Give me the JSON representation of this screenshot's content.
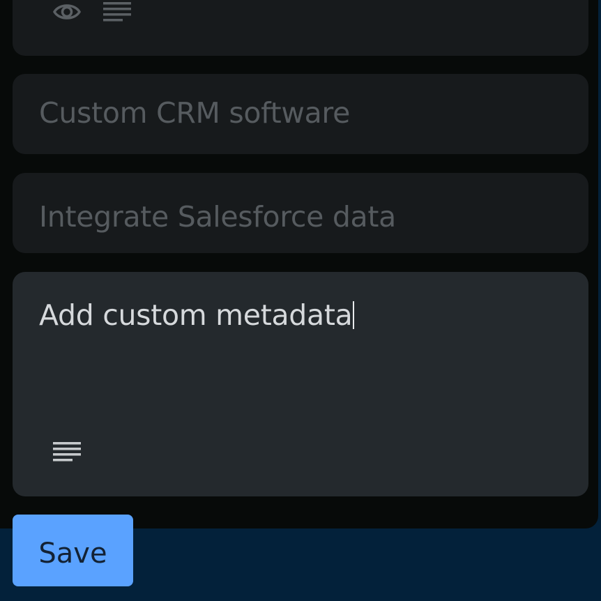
{
  "colors": {
    "page_background": "#03213a",
    "panel_background": "#070a09",
    "card_background": "#171a1c",
    "active_card_background": "#24292d",
    "placeholder_text": "#565b5f",
    "value_text": "#d6d9dc",
    "button_background": "#5aa2ff",
    "button_text": "#132234",
    "icon_color": "#5b6064"
  },
  "top_card": {
    "icons": [
      "eye-icon",
      "text-lines-icon"
    ]
  },
  "fields": {
    "crm_software": {
      "placeholder": "Custom CRM software"
    },
    "salesforce_integration": {
      "placeholder": "Integrate Salesforce data"
    },
    "metadata": {
      "value": "Add custom metadata",
      "icon": "text-lines-icon"
    }
  },
  "actions": {
    "save_label": "Save"
  }
}
